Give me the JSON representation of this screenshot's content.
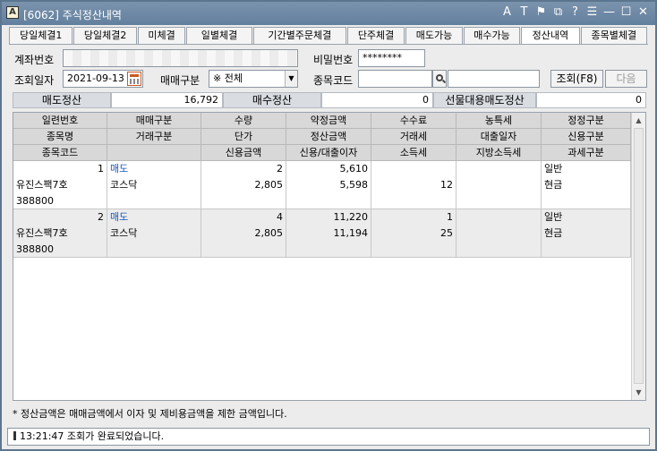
{
  "window": {
    "title": "[6062] 주식정산내역",
    "icon_letter": "A",
    "tools": [
      "A",
      "T",
      "⚑",
      "⧉",
      "?",
      "☰",
      "—",
      "☐",
      "✕"
    ],
    "tool_names": [
      "font-size-icon",
      "text-icon",
      "pin-icon",
      "link-icon",
      "help-icon",
      "print-icon",
      "minimize-icon",
      "maximize-icon",
      "close-icon"
    ]
  },
  "tabs": [
    "당일체결1",
    "당일체결2",
    "미체결",
    "일별체결",
    "기간별주문체결",
    "단주체결",
    "매도가능",
    "매수가능",
    "정산내역",
    "종목별체결"
  ],
  "active_tab": "정산내역",
  "form": {
    "account_label": "계좌번호",
    "password_label": "비밀번호",
    "password_value": "********",
    "date_label": "조회일자",
    "date_value": "2021-09-13",
    "trade_type_label": "매매구분",
    "trade_type_value": "※ 전체",
    "stock_code_label": "종목코드",
    "stock_code_value": "",
    "search_button": "조회(F8)",
    "next_button": "다음"
  },
  "summary": {
    "sell_label": "매도정산",
    "sell_value": "16,792",
    "buy_label": "매수정산",
    "buy_value": "0",
    "futures_label": "선물대용매도정산",
    "futures_value": "0"
  },
  "grid": {
    "headers": [
      [
        "일련번호",
        "매매구분",
        "수량",
        "약정금액",
        "수수료",
        "농특세",
        "정정구분"
      ],
      [
        "종목명",
        "거래구분",
        "단가",
        "정산금액",
        "거래세",
        "대출일자",
        "신용구분"
      ],
      [
        "종목코드",
        "",
        "신용금액",
        "신용/대출이자",
        "소득세",
        "지방소득세",
        "과세구분"
      ]
    ],
    "rows": [
      {
        "serial": "1",
        "trade_type": "매도",
        "qty": "2",
        "contract_amount": "5,610",
        "fee": "",
        "farm_tax": "",
        "correction": "일반",
        "name": "유진스팩7호",
        "market": "코스닥",
        "price": "2,805",
        "settle_amount": "5,598",
        "trade_tax": "12",
        "loan_date": "",
        "credit_type": "현금",
        "code": "388800",
        "blank": "",
        "credit_amount": "",
        "interest": "",
        "income_tax": "",
        "local_tax": "",
        "tax_type": ""
      },
      {
        "serial": "2",
        "trade_type": "매도",
        "qty": "4",
        "contract_amount": "11,220",
        "fee": "1",
        "farm_tax": "",
        "correction": "일반",
        "name": "유진스팩7호",
        "market": "코스닥",
        "price": "2,805",
        "settle_amount": "11,194",
        "trade_tax": "25",
        "loan_date": "",
        "credit_type": "현금",
        "code": "388800",
        "blank": "",
        "credit_amount": "",
        "interest": "",
        "income_tax": "",
        "local_tax": "",
        "tax_type": ""
      }
    ]
  },
  "note": "* 정산금액은 매매금액에서 이자 및 제비용금액을 제한 금액입니다.",
  "status": "13:21:47 조회가 완료되었습니다.",
  "colors": {
    "titlebar": "#6f89a5",
    "header_bg": "#d8d8d8",
    "alt_row": "#ececec",
    "sell_text": "#1d58b3"
  }
}
